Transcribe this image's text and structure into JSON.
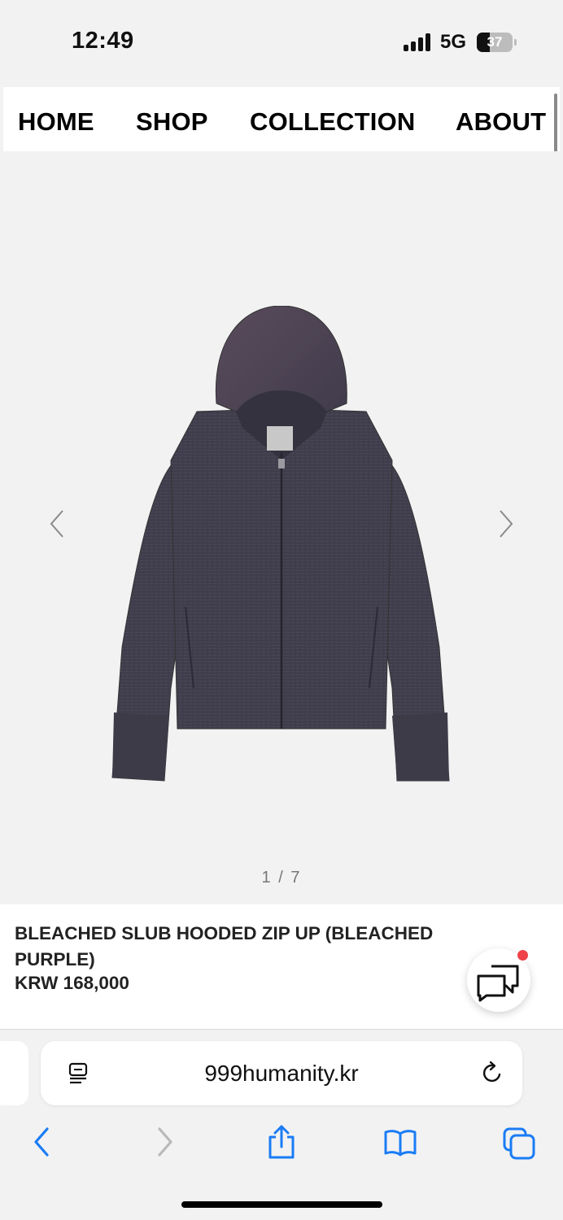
{
  "status_bar": {
    "time": "12:49",
    "network": "5G",
    "battery_level": "37",
    "battery_fraction": 0.37
  },
  "nav": {
    "items": [
      {
        "label": "HOME"
      },
      {
        "label": "SHOP"
      },
      {
        "label": "COLLECTION"
      },
      {
        "label": "ABOUT"
      }
    ]
  },
  "gallery": {
    "image_icon": "hooded-zip-up-product-photo",
    "prev_icon": "chevron-left-icon",
    "next_icon": "chevron-right-icon",
    "counter": "1 / 7"
  },
  "product": {
    "name": "BLEACHED SLUB HOODED ZIP UP (BLEACHED PURPLE)",
    "price": "KRW 168,000"
  },
  "chat": {
    "icon": "chat-bubbles-icon",
    "badge_color": "#ef4249"
  },
  "browser": {
    "url": "999humanity.kr",
    "reader_icon": "page-menu-icon",
    "reload_icon": "reload-icon",
    "toolbar": {
      "back_icon": "back-arrow-icon",
      "forward_icon": "forward-arrow-icon",
      "share_icon": "share-icon",
      "bookmarks_icon": "bookmarks-icon",
      "tabs_icon": "tabs-icon"
    },
    "accent_color": "#1a7cf5"
  }
}
